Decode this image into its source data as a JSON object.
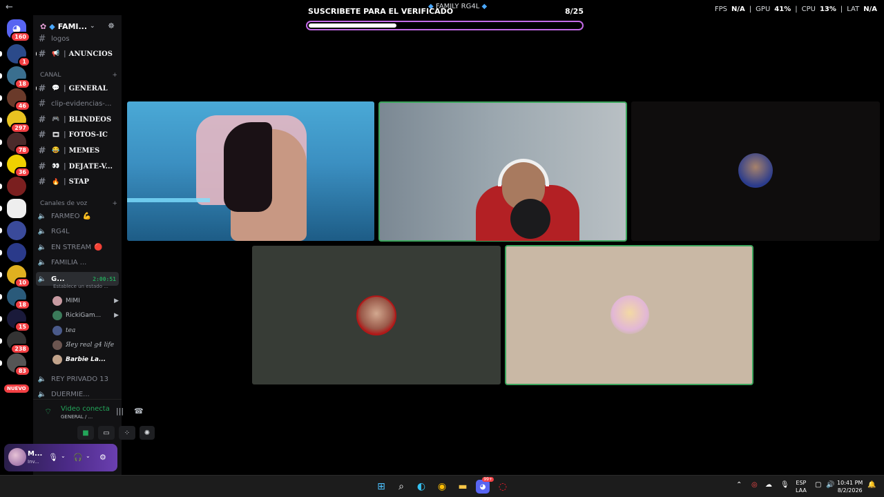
{
  "titlebar": {
    "title": "FAMILY RG4L",
    "fps_label": "FPS",
    "fps_value": "N/A",
    "gpu_label": "GPU",
    "gpu_value": "41%",
    "cpu_label": "CPU",
    "cpu_value": "13%",
    "lat_label": "LAT",
    "lat_value": "N/A"
  },
  "server_rail": {
    "home_badge": "160",
    "servers": [
      {
        "badge": "1"
      },
      {
        "badge": "18"
      },
      {
        "badge": "46"
      },
      {
        "badge": "297"
      },
      {
        "badge": "78"
      },
      {
        "badge": "36"
      },
      {
        "badge": ""
      },
      {
        "badge": ""
      },
      {
        "badge": ""
      },
      {
        "badge": ""
      },
      {
        "badge": "10"
      },
      {
        "badge": "18"
      },
      {
        "badge": "15"
      },
      {
        "badge": "238"
      },
      {
        "badge": "83"
      }
    ],
    "nuevo": "NUEVO"
  },
  "guild": {
    "name": "FAMI...",
    "icon": "gem-icon"
  },
  "channels": {
    "top": [
      {
        "name": "logos",
        "emoji": "",
        "bold": false
      },
      {
        "name": "ANUNCIOS",
        "emoji": "📢",
        "bold": true
      }
    ],
    "cat_canal": "CANAL",
    "text": [
      {
        "name": "GENERAL",
        "emoji": "💬",
        "bold": true
      },
      {
        "name": "clip-evidencias-...",
        "emoji": "",
        "bold": false
      },
      {
        "name": "BLINDEOS",
        "emoji": "🎮",
        "bold": true
      },
      {
        "name": "FOTOS-IC",
        "emoji": "🎞",
        "bold": true
      },
      {
        "name": "MEMES",
        "emoji": "😂",
        "bold": true
      },
      {
        "name": "DEJATE-V...",
        "emoji": "👀",
        "bold": true
      },
      {
        "name": "STAP",
        "emoji": "🔥",
        "bold": true
      }
    ],
    "cat_voice": "Canales de voz",
    "voice": [
      {
        "name": "FARMEO",
        "suffix": "💪"
      },
      {
        "name": "RG4L",
        "suffix": ""
      },
      {
        "name": "EN STREAM",
        "suffix": "🔴"
      },
      {
        "name": "FAMILIA ...",
        "suffix": ""
      }
    ],
    "active_voice": {
      "name": "G...",
      "timer": "2:00:51",
      "status": "Establece un estado ..."
    },
    "voice_users": [
      {
        "name": "MIMI",
        "cam": true
      },
      {
        "name": "RickiGam...",
        "cam": true
      },
      {
        "name": "tea",
        "cam": false
      },
      {
        "name": "Яey real g4 life",
        "cam": false
      },
      {
        "name": "Barbie La...",
        "cam": false
      }
    ],
    "bottom": [
      {
        "name": "REY PRIVADO 13"
      },
      {
        "name": "DUERMIE..."
      }
    ]
  },
  "voice_panel": {
    "title": "Video conectado",
    "subtitle": "GENERAL / ..."
  },
  "user_panel": {
    "name": "M...",
    "status": "Inv..."
  },
  "stream_overlay": {
    "promo": "SUSCRIBETE PARA EL VERIFICADO",
    "count": "8/25",
    "progress": 0.32
  },
  "taskbar": {
    "lang_top": "ESP",
    "lang_bottom": "LAA",
    "time": "10:41 PM",
    "date": "8/2/2026",
    "discord_badge": "99+"
  },
  "colors": {
    "speaking": "#3ba55c",
    "progress_border": "#c46be8",
    "badge": "#f23f43",
    "accent_green": "#23a55a"
  }
}
